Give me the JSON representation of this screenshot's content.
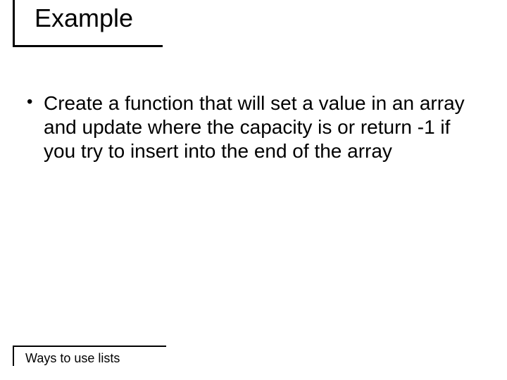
{
  "slide": {
    "title": "Example",
    "body": {
      "bullets": [
        "Create a function that will set a value in an array and update where the capacity is or return -1 if you try to insert into the end of the array"
      ]
    },
    "footer": "Ways to use lists"
  }
}
